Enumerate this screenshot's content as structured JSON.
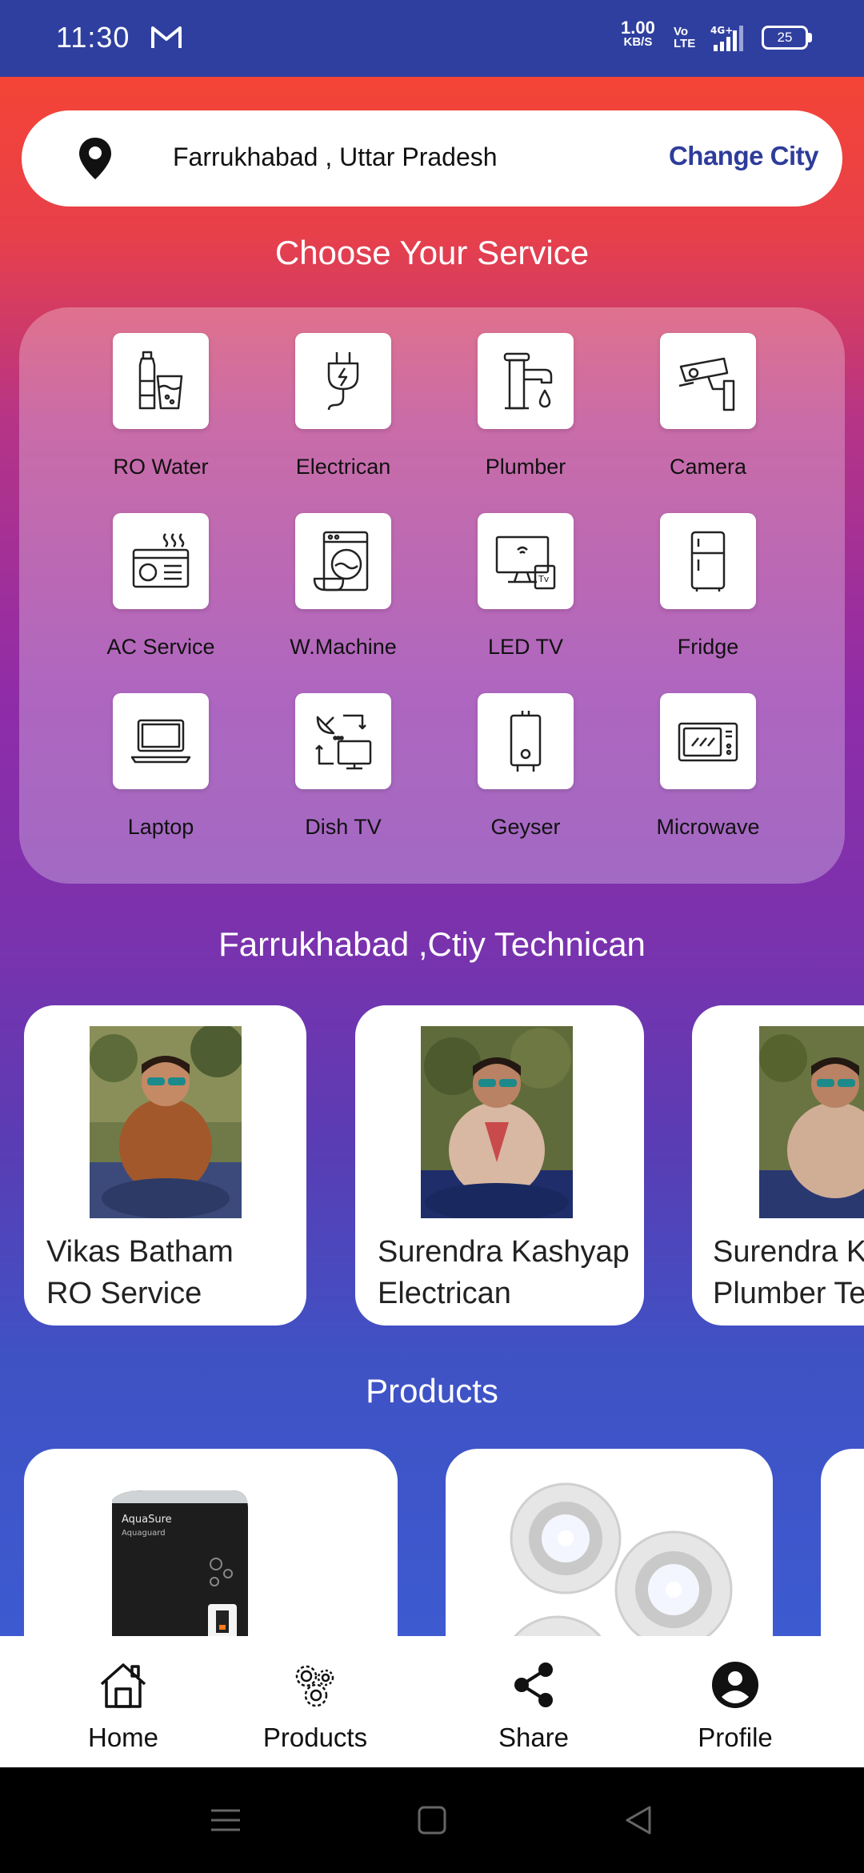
{
  "status_bar": {
    "time": "11:30",
    "speed_value": "1.00",
    "speed_unit": "KB/S",
    "volte_top": "Vo",
    "volte_bottom": "LTE",
    "network": "4G+",
    "battery": "25"
  },
  "location": {
    "city_text": "Farrukhabad , Uttar Pradesh",
    "change_label": "Change City"
  },
  "services": {
    "title": "Choose Your Service",
    "items": [
      {
        "label": "RO Water",
        "icon": "ro-water-icon"
      },
      {
        "label": "Electrican",
        "icon": "electric-plug-icon"
      },
      {
        "label": "Plumber",
        "icon": "faucet-icon"
      },
      {
        "label": "Camera",
        "icon": "cctv-camera-icon"
      },
      {
        "label": "AC Service",
        "icon": "air-conditioner-icon"
      },
      {
        "label": "W.Machine",
        "icon": "washing-machine-icon"
      },
      {
        "label": "LED TV",
        "icon": "led-tv-icon"
      },
      {
        "label": "Fridge",
        "icon": "fridge-icon"
      },
      {
        "label": "Laptop",
        "icon": "laptop-icon"
      },
      {
        "label": "Dish TV",
        "icon": "dish-tv-icon"
      },
      {
        "label": "Geyser",
        "icon": "geyser-icon"
      },
      {
        "label": "Microwave",
        "icon": "microwave-icon"
      }
    ]
  },
  "technicians": {
    "title": "Farrukhabad ,Ctiy Technican",
    "items": [
      {
        "name": "Vikas Batham",
        "role": "RO Service"
      },
      {
        "name": "Surendra Kashyap",
        "role": "Electrican"
      },
      {
        "name": "Surendra Ka",
        "role": "Plumber Te"
      }
    ]
  },
  "products": {
    "title": "Products",
    "items": [
      {
        "label": "AquaSure",
        "sub": "Aquaguard"
      },
      {
        "label": "",
        "sub": ""
      }
    ]
  },
  "bottom_nav": [
    {
      "label": "Home",
      "icon": "home-icon"
    },
    {
      "label": "Products",
      "icon": "gears-icon"
    },
    {
      "label": "Share",
      "icon": "share-icon"
    },
    {
      "label": "Profile",
      "icon": "profile-icon"
    }
  ],
  "colors": {
    "status_bar": "#2f3f9f",
    "accent": "#2e3c9a",
    "gradient_top": "#f44436",
    "gradient_bottom": "#3d5ad0"
  }
}
